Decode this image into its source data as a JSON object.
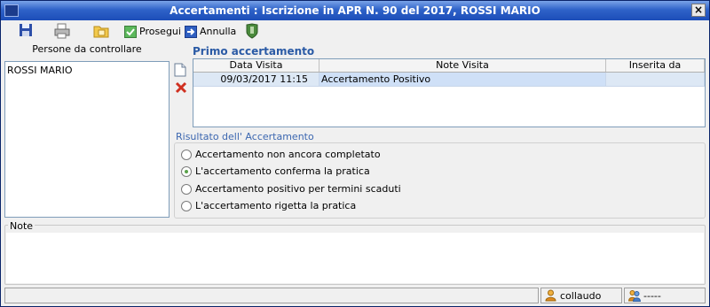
{
  "window": {
    "title": "Accertamenti : Iscrizione in APR N. 90 del 2017, ROSSI MARIO",
    "close_glyph": "×"
  },
  "toolbar": {
    "icons": [
      "save-icon",
      "print-icon",
      "folder-icon"
    ],
    "prosegui_label": "Prosegui",
    "annulla_label": "Annulla"
  },
  "persons": {
    "label": "Persone da controllare",
    "items": [
      "ROSSI MARIO"
    ]
  },
  "accertamento": {
    "section_title": "Primo accertamento",
    "columns": [
      "Data Visita",
      "Note Visita",
      "Inserita da"
    ],
    "rows": [
      {
        "data": "09/03/2017 11:15",
        "note": "Accertamento Positivo",
        "inserita": ""
      }
    ]
  },
  "risultato": {
    "legend": "Risultato dell' Accertamento",
    "options": [
      "Accertamento non ancora completato",
      "L'accertamento conferma la pratica",
      "Accertamento positivo per termini scaduti",
      "L'accertamento rigetta la pratica"
    ],
    "selected_index": 1
  },
  "note": {
    "label": "Note",
    "value": ""
  },
  "status": {
    "user": "collaudo",
    "secondary": "-----"
  },
  "colors": {
    "title_bar": "#2f63c9",
    "accent": "#2a5aa5"
  }
}
